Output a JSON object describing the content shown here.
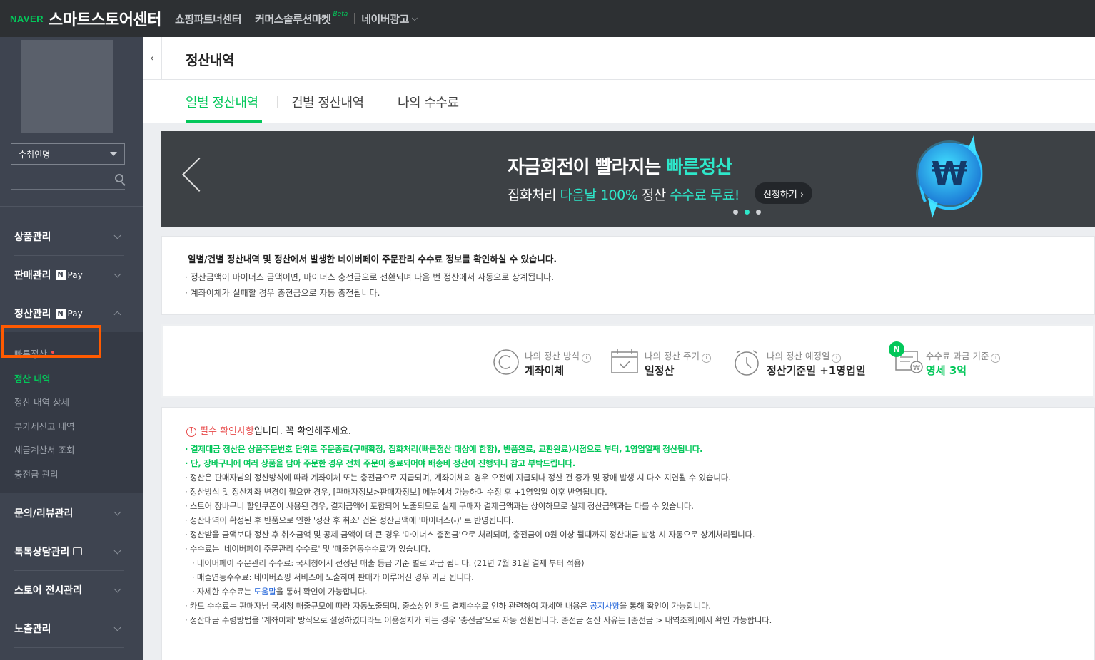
{
  "topbar": {
    "naver": "NAVER",
    "title": "스마트스토어센터",
    "links": [
      "쇼핑파트너센터",
      "커머스솔루션마켓",
      "네이버광고"
    ],
    "beta": "Beta"
  },
  "sidebar": {
    "store_select": "수취인명",
    "menu": [
      {
        "label": "상품관리"
      },
      {
        "label": "판매관리",
        "badge": "Pay"
      },
      {
        "label": "정산관리",
        "badge": "Pay"
      }
    ],
    "submenu": [
      "빠른정산",
      "정산 내역",
      "정산 내역 상세",
      "부가세신고 내역",
      "세금계산서 조회",
      "충전금 관리"
    ],
    "menu_bottom": [
      "문의/리뷰관리",
      "톡톡상담관리",
      "스토어 전시관리",
      "노출관리"
    ]
  },
  "page": {
    "title": "정산내역",
    "tabs": [
      "일별 정산내역",
      "건별 정산내역",
      "나의 수수료"
    ]
  },
  "banner": {
    "title_prefix": "자금회전이 빨라지는 ",
    "title_highlight": "빠른정산",
    "sub_1": "집화처리 ",
    "sub_hl_1": "다음날 100%",
    "sub_2": " 정산 ",
    "sub_hl_2": "수수료 무료!",
    "cta": "신청하기 ›",
    "coin_symbol": "₩"
  },
  "info": {
    "head": "일별/건별 정산내역 및 정산에서 발생한 네이버페이 주문관리 수수료 정보를 확인하실 수 있습니다.",
    "lines": [
      "· 정산금액이 마이너스 금액이면, 마이너스 충전금으로 전환되며 다음 번 정산에서 자동으로 상계됩니다.",
      "· 계좌이체가 실패할 경우 충전금으로 자동 충전됩니다."
    ]
  },
  "summary": {
    "method_label": "나의 정산 방식",
    "method_value": "계좌이체",
    "cycle_label": "나의 정산 주기",
    "cycle_value": "일정산",
    "date_label": "나의 정산 예정일",
    "date_value": "정산기준일 +1영업일",
    "fee_label": "수수료 과금 기준",
    "fee_value": "영세 3억",
    "q": "i",
    "n_badge": "N",
    "fee_icon": "₩"
  },
  "notice": {
    "head_red": "필수 확인사항",
    "head_rest": "입니다. 꼭 확인해주세요.",
    "alert": "!",
    "lines": [
      "· 결제대금 정산은 상품주문번호 단위로 주문종료(구매확정, 집화처리(빠른정산 대상에 한함), 반품완료, 교환완료)시점으로 부터, 1영업일째 정산됩니다.",
      "· 단, 장바구니에 여러 상품을 담아 주문한 경우 전체 주문이 종료되어야 배송비 정산이 진행되니 참고 부탁드립니다.",
      "· 정산은 판매자님의 정산방식에 따라 계좌이체 또는 충전금으로 지급되며, 계좌이체의 경우 오전에 지급되나 정산 건 증가 및 장애 발생 시 다소 지연될 수 있습니다.",
      "· 정산방식 및 정산계좌 변경이 필요한 경우, [판매자정보>판매자정보] 메뉴에서 가능하며 수정 후 +1영업일 이후 반영됩니다.",
      "· 스토어 장바구니 할인쿠폰이 사용된 경우, 결제금액에 포함되어 노출되므로 실제 구매자 결제금액과는 상이하므로 실제 정산금액과는 다를 수 있습니다.",
      "· 정산내역이 확정된 후 반품으로 인한 '정산 후 취소' 건은 정산금액에 '마이너스(-)' 로 반영됩니다.",
      "· 정산받을 금액보다 정산 후 취소금액 및 공제 금액이 더 큰 경우 '마이너스 충전금'으로 처리되며, 충전금이 0원 이상 될때까지 정산대금 발생 시 자동으로 상계처리됩니다.",
      "· 수수료는 '네이버페이 주문관리 수수료' 및 '매출연동수수료'가 있습니다.",
      "· 네이버페이 주문관리 수수료: 국세청에서 선정된 매출 등급 기준 별로 과금 됩니다. (21년 7월 31일 결제 부터 적용)",
      "· 매출연동수수료: 네이버쇼핑 서비스에 노출하여 판매가 이루어진 경우 과금 됩니다.",
      "· 카드 수수료는 판매자님 국세청 매출규모에 따라 자동노출되며, 중소상인 카드 결제수수료 인하 관련하여 자세한 내용은 ",
      "· 정산대금 수령방법을 '계좌이체' 방식으로 설정하였더라도 이용정지가 되는 경우 '충전금'으로 자동 전환됩니다. 충전금 정산 사유는 [충전금 > 내역조회]에서 확인 가능합니다."
    ],
    "help_pre": "· 자세한 수수료는 ",
    "help_link": "도움말",
    "help_post": "을 통해 확인이 가능합니다.",
    "card_link": "공지사항",
    "card_post": "을 통해 확인이 가능합니다."
  }
}
